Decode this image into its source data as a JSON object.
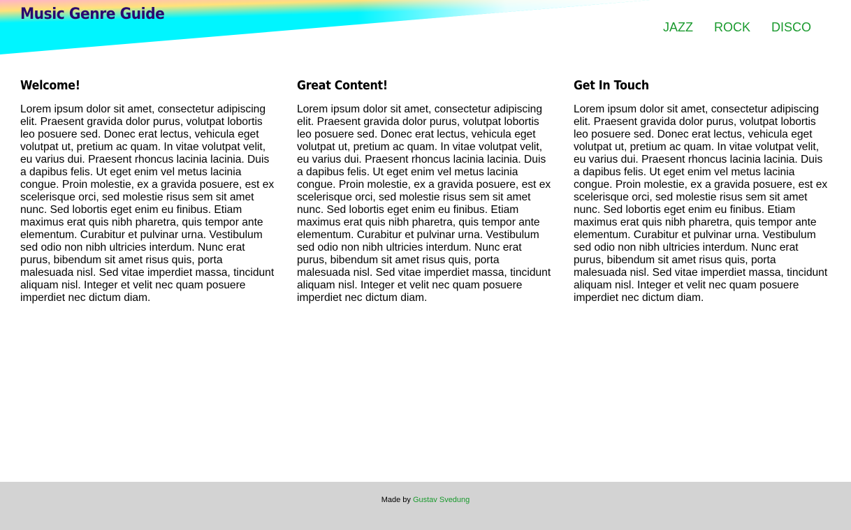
{
  "header": {
    "title": "Music Genre Guide",
    "nav": [
      {
        "label": "JAZZ"
      },
      {
        "label": "ROCK"
      },
      {
        "label": "DISCO"
      }
    ]
  },
  "main": {
    "columns": [
      {
        "heading": "Welcome!",
        "body": "Lorem ipsum dolor sit amet, consectetur adipiscing elit. Praesent gravida dolor purus, volutpat lobortis leo posuere sed. Donec erat lectus, vehicula eget volutpat ut, pretium ac quam. In vitae volutpat velit, eu varius dui. Praesent rhoncus lacinia lacinia. Duis a dapibus felis. Ut eget enim vel metus lacinia congue. Proin molestie, ex a gravida posuere, est ex scelerisque orci, sed molestie risus sem sit amet nunc. Sed lobortis eget enim eu finibus. Etiam maximus erat quis nibh pharetra, quis tempor ante elementum. Curabitur et pulvinar urna. Vestibulum sed odio non nibh ultricies interdum. Nunc erat purus, bibendum sit amet risus quis, porta malesuada nisl. Sed vitae imperdiet massa, tincidunt aliquam nisl. Integer et velit nec quam posuere imperdiet nec dictum diam."
      },
      {
        "heading": "Great Content!",
        "body": "Lorem ipsum dolor sit amet, consectetur adipiscing elit. Praesent gravida dolor purus, volutpat lobortis leo posuere sed. Donec erat lectus, vehicula eget volutpat ut, pretium ac quam. In vitae volutpat velit, eu varius dui. Praesent rhoncus lacinia lacinia. Duis a dapibus felis. Ut eget enim vel metus lacinia congue. Proin molestie, ex a gravida posuere, est ex scelerisque orci, sed molestie risus sem sit amet nunc. Sed lobortis eget enim eu finibus. Etiam maximus erat quis nibh pharetra, quis tempor ante elementum. Curabitur et pulvinar urna. Vestibulum sed odio non nibh ultricies interdum. Nunc erat purus, bibendum sit amet risus quis, porta malesuada nisl. Sed vitae imperdiet massa, tincidunt aliquam nisl. Integer et velit nec quam posuere imperdiet nec dictum diam."
      },
      {
        "heading": "Get In Touch",
        "body": "Lorem ipsum dolor sit amet, consectetur adipiscing elit. Praesent gravida dolor purus, volutpat lobortis leo posuere sed. Donec erat lectus, vehicula eget volutpat ut, pretium ac quam. In vitae volutpat velit, eu varius dui. Praesent rhoncus lacinia lacinia. Duis a dapibus felis. Ut eget enim vel metus lacinia congue. Proin molestie, ex a gravida posuere, est ex scelerisque orci, sed molestie risus sem sit amet nunc. Sed lobortis eget enim eu finibus. Etiam maximus erat quis nibh pharetra, quis tempor ante elementum. Curabitur et pulvinar urna. Vestibulum sed odio non nibh ultricies interdum. Nunc erat purus, bibendum sit amet risus quis, porta malesuada nisl. Sed vitae imperdiet massa, tincidunt aliquam nisl. Integer et velit nec quam posuere imperdiet nec dictum diam."
      }
    ]
  },
  "footer": {
    "prefix": "Made by ",
    "author_link": "Gustav Svedung"
  },
  "colors": {
    "title": "#2a0a6e",
    "nav_link": "#1a9a2e",
    "footer_bg": "#d3d3d3",
    "rainbow": [
      "#ff9ad0",
      "#ffe27a",
      "#00f5ff"
    ]
  }
}
